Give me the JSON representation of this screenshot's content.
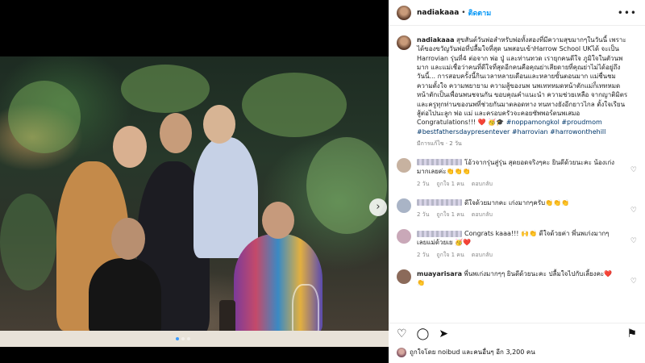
{
  "post": {
    "username": "nadiakaaa",
    "separator": "•",
    "follow_label": "ติดตาม",
    "more_label": "•••",
    "caption_user": "nadiakaaa",
    "caption_text": "สุขสันต์วันพ่อสำหรับพ่อทั้งสองที่มีความสุขมากๆในวันนี้ เพราะได้ของขวัญวันพ่อที่ปลื้มใจที่สุด นพสอบเข้าHarrow School UKได้ จะเป็น Harrovian รุ่นที่4 ต่อจาก พ่อ ปู่ และท่านทวด เรายุกคนดีใจ ภูมิใจในตัวนพมาก และแม่เชื่อว่าคนที่ดีใจที่สุดอีกคนคือคุณย่าเสียดายที่คุณย่าไม่ได้อยู่ถึงวันนี้... การสอบครั้งนี้กินเวลาหลายเดือนและหลายขั้นตอนมาก แม่ชื่นชมความตั้งใจ ความพยายาม ความสู้ของนพ นพเททหมดหน้าตักแม่ก็เททหมดหน้าตักเป็นเพื่อนพนชจนกัน ขอบคุณคำแนะนำ ความช่วยเหลือ จากญาติมิตร และครูทุกท่านของนพที่ช่วยกันมาตลอดทาง ทนทางยังอีกยาวไกล ตั้งใจเรียนสู้ต่อไปนะลูก พ่อ แม่ และครอบครัวจะคอยซัพพอร์ตนพเสมอ Congratulations!!! ❤️ 🥳🎓",
    "hashtags": "#noppamongkol #proudmom #bestfathersdaypresentever #harrovian #harrowonthehill",
    "edited_label": "มีการแก้ไข · 2 วัน"
  },
  "comments": [
    {
      "text": "โอ้วจากรุ่นสู่รุ่น สุดยอดจริงๆคะ ยินดีด้วยนะคะ น้องเก่งมากเลยค่ะ👏👏👏",
      "time": "2 วัน",
      "likes": "ถูกใจ 1 คน",
      "reply": "ตอบกลับ",
      "avatar_color": "#c7b2a0"
    },
    {
      "text": "ดีใจด้วยมากคะ เก่งมากๆครับ👏👏👏",
      "time": "2 วัน",
      "likes": "ถูกใจ 1 คน",
      "reply": "ตอบกลับ",
      "avatar_color": "#a9b4c6"
    },
    {
      "text": "Congrats kaaa!!! 🙌👏 ดีใจด้วยค่า พี่นพเก่งมากๆเลยแม่ด้วยเย 🥳❤️",
      "time": "2 วัน",
      "likes": "ถูกใจ 1 คน",
      "reply": "ตอบกลับ",
      "avatar_color": "#c9a8b8"
    },
    {
      "user": "muayarisara",
      "text": "พี่นพเก่งมากๆๆ ยินดีด้วยนะคะ ปลื้มใจไปกับเลี้ยงคะ❤️ 👏",
      "avatar_color": "#8b6a5a"
    }
  ],
  "actions": {
    "like_icon": "♡",
    "comment_icon": "◯",
    "share_icon": "➤",
    "save_icon": "⚑"
  },
  "likes": {
    "text": "ถูกใจโดย noibud และคนอื่นๆ อีก 3,200 คน"
  },
  "carousel": {
    "next_label": "›"
  }
}
